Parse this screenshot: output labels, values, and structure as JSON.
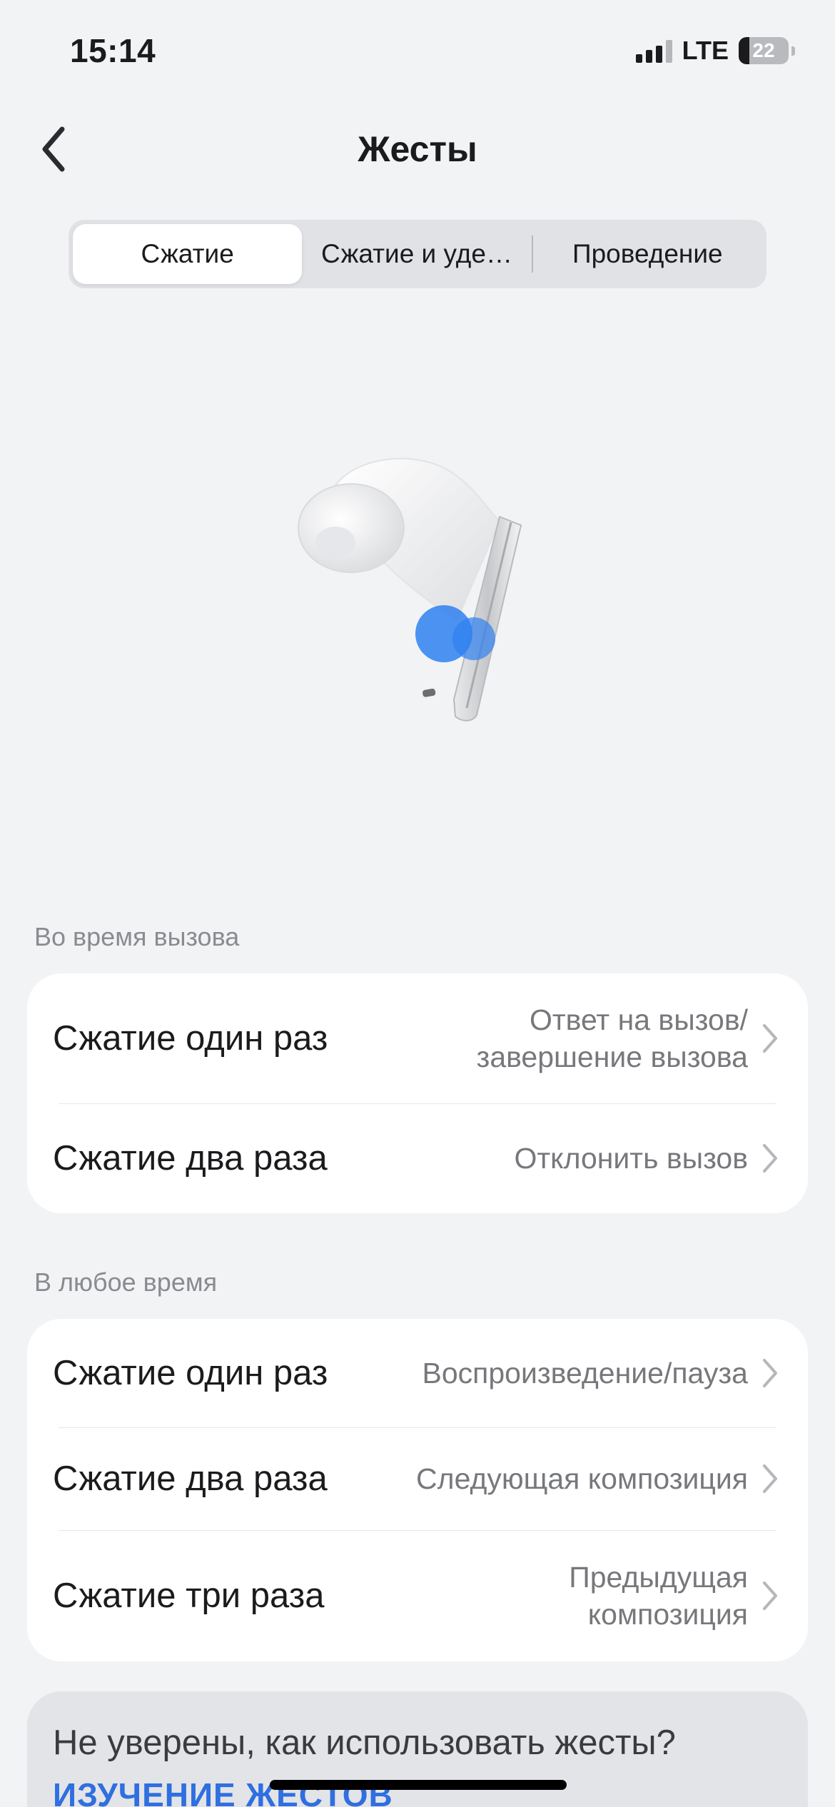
{
  "status_bar": {
    "time": "15:14",
    "network": "LTE",
    "battery_level": "22",
    "battery_fraction": 0.22
  },
  "nav": {
    "title": "Жесты",
    "back_icon": "chevron-left-icon"
  },
  "tabs": [
    {
      "label": "Сжатие",
      "active": true
    },
    {
      "label": "Сжатие и уде…",
      "active": false
    },
    {
      "label": "Проведение",
      "active": false
    }
  ],
  "sections": [
    {
      "label": "Во время вызова",
      "rows": [
        {
          "label": "Сжатие один раз",
          "value": "Ответ на вызов/ завершение вызова"
        },
        {
          "label": "Сжатие два раза",
          "value": "Отклонить вызов"
        }
      ]
    },
    {
      "label": "В любое время",
      "rows": [
        {
          "label": "Сжатие один раз",
          "value": "Воспроизведение/пауза"
        },
        {
          "label": "Сжатие два раза",
          "value": "Следующая композиция"
        },
        {
          "label": "Сжатие три раза",
          "value": "Предыдущая композиция"
        }
      ]
    }
  ],
  "help": {
    "text": "Не уверены, как использовать жесты?",
    "link": "ИЗУЧЕНИЕ ЖЕСТОВ"
  },
  "colors": {
    "background": "#f2f3f5",
    "accent_blue": "#2f80f0",
    "link_blue": "#2f6fe0"
  }
}
